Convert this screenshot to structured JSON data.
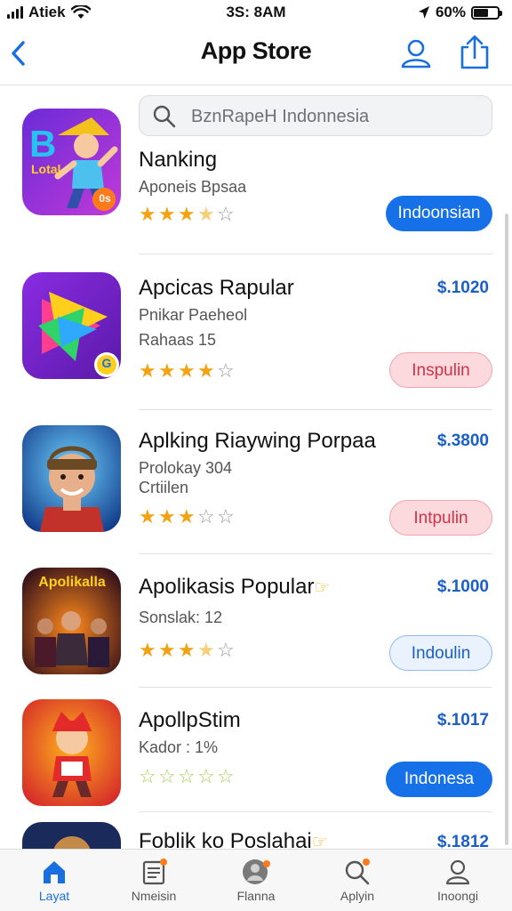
{
  "status": {
    "carrier": "Atiek",
    "time": "3S: 8AM",
    "battery": "60%",
    "battery_level": 0.6
  },
  "nav": {
    "title": "App Store"
  },
  "search": {
    "placeholder": "BznRapeH Indonnesia"
  },
  "apps": [
    {
      "name": "Nanking",
      "sub1": "Aponeis Bpsaa",
      "sub2": "",
      "price": "",
      "rating": 3.5,
      "button": "Indoonsian",
      "button_style": "primary"
    },
    {
      "name": "Apcicas Rapular",
      "sub1": "Pnikar Paeheol",
      "sub2": "Rahaas 15",
      "price": "$.1020",
      "rating": 4,
      "button": "Inspulin",
      "button_style": "pink"
    },
    {
      "name": "Aplking Riaywing Porpaa",
      "sub1": "Prolokay 304",
      "sub2": "Crtiilen",
      "price": "$.3800",
      "rating": 3,
      "button": "Intpulin",
      "button_style": "pink"
    },
    {
      "name": "Apolikasis Popular",
      "sub1": "Sonslak: 12",
      "sub2": "",
      "price": "$.1000",
      "rating": 3.5,
      "button": "Indoulin",
      "button_style": "light"
    },
    {
      "name": "ApollpStim",
      "sub1": "Kador : 1%",
      "sub2": "",
      "price": "$.1017",
      "rating": 0,
      "button": "Indonesa",
      "button_style": "primary"
    },
    {
      "name": "Foblik ko Poslahai",
      "sub1": "",
      "sub2": "",
      "price": "$.1812",
      "rating": 0,
      "button": "",
      "button_style": ""
    }
  ],
  "icon_texts": {
    "app1": "B",
    "app1_small": "Lotal",
    "app1_badge": "0s",
    "app2_badge": "G",
    "app4_title": "Apolikalla"
  },
  "tabs": [
    {
      "label": "Layat",
      "icon": "home-icon"
    },
    {
      "label": "Nmeisin",
      "icon": "news-icon"
    },
    {
      "label": "Flanna",
      "icon": "profile-icon"
    },
    {
      "label": "Aplyin",
      "icon": "search-icon"
    },
    {
      "label": "Inoongi",
      "icon": "account-icon"
    }
  ],
  "colors": {
    "accent": "#1670e8",
    "pink_button": "#fbd9dc",
    "star": "#f2a313"
  }
}
